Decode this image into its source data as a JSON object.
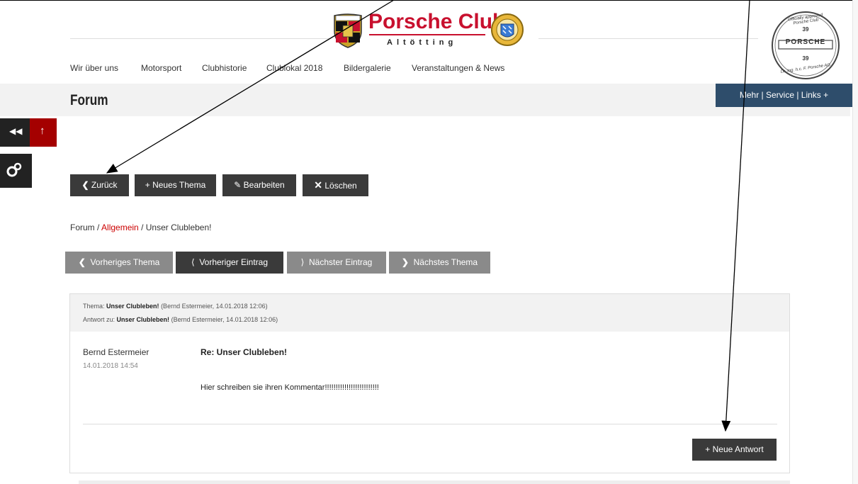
{
  "logo": {
    "title": "Porsche Club",
    "subtitle": "Altötting"
  },
  "seal": {
    "top": "Officially approved Porsche Club",
    "number": "39",
    "brand": "PORSCHE",
    "bottom": "Dr. Ing. h.c. F. Porsche AG"
  },
  "nav": [
    "Wir über uns",
    "Motorsport",
    "Clubhistorie",
    "Clublokal 2018",
    "Bildergalerie",
    "Veranstaltungen & News"
  ],
  "page_title": "Forum",
  "mehr_button": "Mehr | Service | Links  +",
  "side": {
    "back_icon": "double-chevron-left-icon",
    "up_icon": "arrow-up-icon",
    "settings_icon": "gears-icon"
  },
  "toolbar": {
    "back": "Zurück",
    "new_topic": "+ Neues Thema",
    "edit": "Bearbeiten",
    "delete": "Löschen"
  },
  "breadcrumb": {
    "root": "Forum",
    "sep": "/",
    "category": "Allgemein",
    "topic": "Unser Clubleben!"
  },
  "pager": {
    "prev_topic": "Vorheriges Thema",
    "prev_entry": "Vorheriger Eintrag",
    "next_entry": "Nächster Eintrag",
    "next_topic": "Nächstes Thema"
  },
  "post": {
    "head1_label": "Thema:",
    "head1_title": "Unser Clubleben!",
    "head1_meta": "(Bernd Estermeier, 14.01.2018  12:06)",
    "head2_label": "Antwort zu:",
    "head2_title": "Unser Clubleben!",
    "head2_meta": "(Bernd Estermeier, 14.01.2018  12:06)",
    "author": "Bernd Estermeier",
    "date": "14.01.2018  14:54",
    "subject": "Re: Unser Clubleben!",
    "body": "Hier schreiben sie ihren Kommentar!!!!!!!!!!!!!!!!!!!!!!!!!"
  },
  "reply_button": "+ Neue Antwort",
  "colors": {
    "brand_red": "#c8102e",
    "nav_blue": "#2e4d6b",
    "dark_button": "#3a3a3a",
    "grey_button": "#8a8a8a"
  }
}
